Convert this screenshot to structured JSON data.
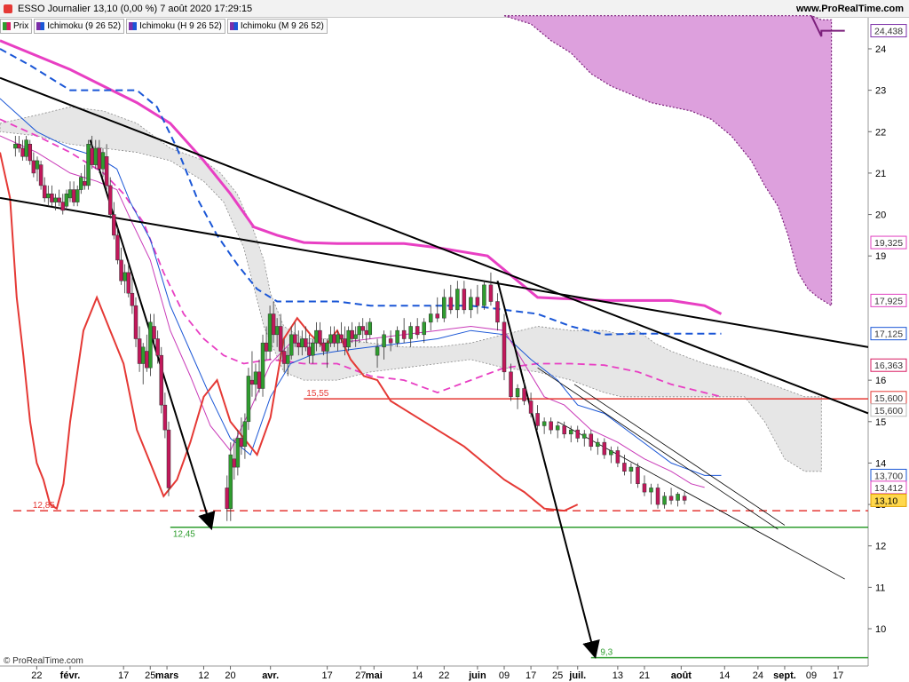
{
  "header": {
    "title": "ESSO Journalier 13,10 (0,00 %) 7 août 2020 17:29:15",
    "site": "www.ProRealTime.com"
  },
  "legend": [
    {
      "label": "Prix",
      "color": "#2e9d2e"
    },
    {
      "label": "Ichimoku (9 26 52)",
      "color": "#7b2fa8"
    },
    {
      "label": "Ichimoku (H 9 26 52)",
      "color": "#7b2fa8"
    },
    {
      "label": "Ichimoku (M 9 26 52)",
      "color": "#7b2fa8"
    }
  ],
  "footer": {
    "copyright": "© ProRealTime.com"
  },
  "chart_data": {
    "type": "candlestick",
    "title": "ESSO Journalier",
    "y_ticks": [
      10,
      11,
      12,
      13,
      14,
      15,
      16,
      19,
      20,
      21,
      22,
      23,
      24
    ],
    "ylim": [
      9.1,
      24.75
    ],
    "x_ticks": [
      {
        "label": "22",
        "day": -10
      },
      {
        "label": "févr.",
        "day": 0,
        "bold": true
      },
      {
        "label": "17",
        "day": 16
      },
      {
        "label": "25",
        "day": 24
      },
      {
        "label": "mars",
        "day": 29,
        "bold": true
      },
      {
        "label": "12",
        "day": 40
      },
      {
        "label": "20",
        "day": 48
      },
      {
        "label": "avr.",
        "day": 60,
        "bold": true
      },
      {
        "label": "17",
        "day": 77
      },
      {
        "label": "27",
        "day": 87
      },
      {
        "label": "mai",
        "day": 91,
        "bold": true
      },
      {
        "label": "14",
        "day": 104
      },
      {
        "label": "22",
        "day": 112
      },
      {
        "label": "juin",
        "day": 122,
        "bold": true
      },
      {
        "label": "09",
        "day": 130
      },
      {
        "label": "17",
        "day": 138
      },
      {
        "label": "25",
        "day": 146
      },
      {
        "label": "juil.",
        "day": 152,
        "bold": true
      },
      {
        "label": "13",
        "day": 164
      },
      {
        "label": "21",
        "day": 172
      },
      {
        "label": "août",
        "day": 183,
        "bold": true
      },
      {
        "label": "14",
        "day": 196
      },
      {
        "label": "24",
        "day": 206
      },
      {
        "label": "sept.",
        "day": 214,
        "bold": true
      },
      {
        "label": "09",
        "day": 222
      },
      {
        "label": "17",
        "day": 230
      }
    ],
    "price_badges": [
      {
        "label": "24,438",
        "value": 24.438,
        "color": "#7b2fa8",
        "text": "#333333",
        "bg": "#ffffff"
      },
      {
        "label": "19,325",
        "value": 19.325,
        "color": "#e040c0",
        "text": "#333333",
        "bg": "#ffffff"
      },
      {
        "label": "17,925",
        "value": 17.925,
        "color": "#e040c0",
        "text": "#333333",
        "bg": "#ffffff"
      },
      {
        "label": "17,125",
        "value": 17.125,
        "color": "#1a56d6",
        "text": "#333333",
        "bg": "#ffffff"
      },
      {
        "label": "16,363",
        "value": 16.363,
        "color": "#d81b60",
        "text": "#333333",
        "bg": "#ffffff"
      },
      {
        "label": "15,600",
        "value": 15.6,
        "color": "#e53935",
        "text": "#333333",
        "bg": "#ffffff"
      },
      {
        "label": "15,600",
        "value": 15.6,
        "color": "#bbbbbb",
        "text": "#333333",
        "bg": "#ffffff"
      },
      {
        "label": "13,700",
        "value": 13.7,
        "color": "#1a56d6",
        "text": "#333333",
        "bg": "#ffffff"
      },
      {
        "label": "13,412",
        "value": 13.412,
        "color": "#e040c0",
        "text": "#333333",
        "bg": "#ffffff"
      },
      {
        "label": "13,10",
        "value": 13.1,
        "color": "#e0a000",
        "text": "#000000",
        "bg": "#ffd84d"
      }
    ],
    "horizontal_levels": [
      {
        "label": "15,55",
        "value": 15.55,
        "color": "#e53935",
        "dashed": false
      },
      {
        "label": "12,85",
        "value": 12.85,
        "color": "#e53935",
        "dashed": true
      },
      {
        "label": "12,45",
        "value": 12.45,
        "color": "#2e9d2e",
        "dashed": false
      },
      {
        "label": "9,3",
        "value": 9.3,
        "color": "#2e9d2e",
        "dashed": false
      }
    ],
    "candles": [
      [
        -15,
        21.6,
        21.9,
        21.4,
        21.7
      ],
      [
        -14,
        21.7,
        21.9,
        21.5,
        21.6
      ],
      [
        -13,
        21.6,
        21.8,
        21.3,
        21.4
      ],
      [
        -12,
        21.4,
        21.9,
        21.3,
        21.8
      ],
      [
        -11,
        21.7,
        21.8,
        21.2,
        21.3
      ],
      [
        -10,
        21.3,
        21.5,
        20.9,
        21.0
      ],
      [
        -9,
        21.1,
        21.4,
        20.8,
        21.3
      ],
      [
        -8,
        21.2,
        21.3,
        20.6,
        20.7
      ],
      [
        -7,
        20.7,
        20.9,
        20.3,
        20.4
      ],
      [
        -6,
        20.4,
        20.7,
        20.2,
        20.5
      ],
      [
        -5,
        20.5,
        20.7,
        20.2,
        20.3
      ],
      [
        -4,
        20.3,
        20.5,
        20.1,
        20.4
      ],
      [
        -3,
        20.4,
        20.6,
        20.2,
        20.3
      ],
      [
        -2,
        20.3,
        20.5,
        20.0,
        20.1
      ],
      [
        -1,
        20.2,
        20.6,
        20.1,
        20.5
      ],
      [
        0,
        20.4,
        20.8,
        20.3,
        20.6
      ],
      [
        1,
        20.6,
        20.8,
        20.2,
        20.3
      ],
      [
        2,
        20.3,
        20.7,
        20.2,
        20.6
      ],
      [
        3,
        20.6,
        21.0,
        20.5,
        20.9
      ],
      [
        4,
        20.8,
        21.2,
        20.6,
        20.7
      ],
      [
        5,
        20.7,
        21.8,
        20.6,
        21.7
      ],
      [
        6,
        21.6,
        21.9,
        21.1,
        21.2
      ],
      [
        7,
        21.2,
        21.8,
        21.1,
        21.6
      ],
      [
        8,
        21.6,
        21.8,
        21.0,
        21.1
      ],
      [
        9,
        21.1,
        21.6,
        20.9,
        21.5
      ],
      [
        10,
        21.4,
        21.7,
        20.6,
        20.7
      ],
      [
        11,
        20.7,
        20.9,
        19.9,
        20.0
      ],
      [
        12,
        20.0,
        20.3,
        19.4,
        19.5
      ],
      [
        13,
        19.5,
        19.7,
        18.8,
        18.9
      ],
      [
        14,
        18.9,
        19.2,
        18.3,
        18.4
      ],
      [
        15,
        18.4,
        18.8,
        18.1,
        18.6
      ],
      [
        16,
        18.6,
        18.9,
        18.0,
        18.1
      ],
      [
        17,
        18.1,
        18.5,
        17.6,
        17.8
      ],
      [
        18,
        17.8,
        18.0,
        16.8,
        17.0
      ],
      [
        19,
        17.0,
        17.3,
        16.2,
        16.4
      ],
      [
        20,
        16.4,
        16.9,
        15.9,
        16.8
      ],
      [
        21,
        16.7,
        17.1,
        16.2,
        16.3
      ],
      [
        22,
        16.3,
        17.6,
        16.1,
        17.4
      ],
      [
        23,
        17.3,
        17.6,
        16.8,
        17.0
      ],
      [
        24,
        17.0,
        17.2,
        16.4,
        16.6
      ],
      [
        25,
        16.6,
        16.8,
        15.2,
        15.4
      ],
      [
        26,
        15.4,
        15.7,
        14.6,
        14.8
      ],
      [
        27,
        14.8,
        15.0,
        13.2,
        13.4
      ],
      [
        28,
        13.4,
        13.7,
        12.6,
        12.9
      ],
      [
        29,
        12.9,
        14.5,
        12.6,
        14.2
      ],
      [
        30,
        14.1,
        14.6,
        13.6,
        13.9
      ],
      [
        31,
        13.9,
        14.8,
        13.7,
        14.6
      ],
      [
        32,
        14.6,
        15.1,
        14.2,
        14.4
      ],
      [
        33,
        14.4,
        15.2,
        14.1,
        15.0
      ],
      [
        34,
        15.0,
        16.3,
        14.8,
        16.1
      ],
      [
        35,
        16.0,
        16.7,
        15.6,
        15.9
      ],
      [
        36,
        15.9,
        16.4,
        15.5,
        16.2
      ],
      [
        37,
        16.2,
        16.5,
        15.7,
        15.8
      ],
      [
        38,
        15.8,
        17.1,
        15.6,
        16.9
      ],
      [
        39,
        16.9,
        17.3,
        16.5,
        16.7
      ],
      [
        40,
        16.7,
        17.8,
        16.5,
        17.6
      ],
      [
        41,
        17.6,
        17.9,
        16.9,
        17.1
      ],
      [
        42,
        17.1,
        17.5,
        16.8,
        17.3
      ],
      [
        43,
        17.3,
        17.6,
        16.5,
        16.7
      ],
      [
        44,
        16.7,
        17.0,
        16.2,
        16.4
      ],
      [
        45,
        16.4,
        16.8,
        16.1,
        16.6
      ],
      [
        46,
        16.6,
        17.3,
        16.5,
        17.1
      ],
      [
        47,
        17.1,
        17.4,
        16.8,
        16.9
      ],
      [
        48,
        16.9,
        17.2,
        16.6,
        16.8
      ],
      [
        49,
        16.8,
        17.2,
        16.6,
        17.0
      ],
      [
        50,
        17.0,
        17.3,
        16.7,
        16.8
      ],
      [
        51,
        16.8,
        17.1,
        16.4,
        16.6
      ],
      [
        52,
        16.6,
        17.0,
        16.4,
        16.9
      ],
      [
        53,
        16.9,
        17.4,
        16.7,
        17.2
      ],
      [
        54,
        17.2,
        17.4,
        16.8,
        16.9
      ],
      [
        55,
        16.9,
        17.0,
        16.6,
        16.7
      ],
      [
        56,
        16.7,
        17.0,
        16.3,
        16.9
      ],
      [
        57,
        16.9,
        17.3,
        16.8,
        17.1
      ],
      [
        58,
        17.1,
        17.3,
        16.8,
        16.9
      ],
      [
        59,
        16.9,
        17.2,
        16.7,
        17.1
      ],
      [
        60,
        17.1,
        17.4,
        16.9,
        17.0
      ],
      [
        61,
        17.0,
        17.3,
        16.6,
        16.8
      ],
      [
        62,
        16.8,
        17.3,
        16.7,
        17.2
      ],
      [
        63,
        17.2,
        17.4,
        16.9,
        17.0
      ],
      [
        64,
        17.0,
        17.3,
        16.8,
        17.1
      ],
      [
        65,
        17.1,
        17.4,
        16.9,
        17.3
      ],
      [
        66,
        17.3,
        17.5,
        17.0,
        17.2
      ],
      [
        67,
        17.2,
        17.4,
        16.9,
        17.1
      ],
      [
        68,
        17.1,
        17.5,
        17.0,
        17.4
      ]
    ]
  }
}
